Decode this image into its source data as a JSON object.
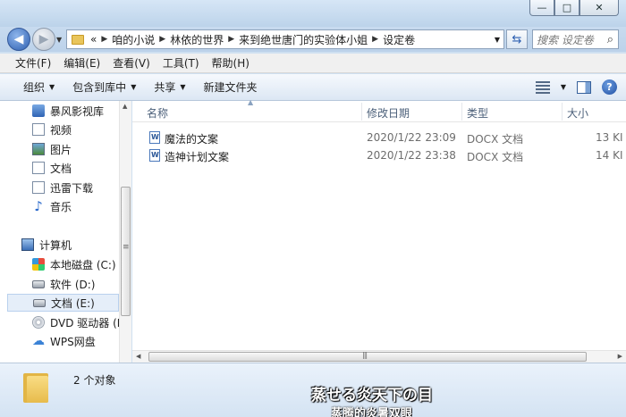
{
  "window": {
    "min": "—",
    "max": "□",
    "close": "✕"
  },
  "address": {
    "overflow": "«",
    "crumbs": [
      "咱的小说",
      "林依的世界",
      "来到绝世唐门的实验体小姐",
      "设定卷"
    ]
  },
  "search": {
    "placeholder": "搜索 设定卷"
  },
  "menubar": [
    "文件(F)",
    "编辑(E)",
    "查看(V)",
    "工具(T)",
    "帮助(H)"
  ],
  "toolbar": {
    "organize": "组织",
    "include_library": "包含到库中",
    "share": "共享",
    "new_folder": "新建文件夹"
  },
  "navpane": {
    "items": [
      {
        "label": "暴风影视库",
        "icon": "video-library-icon"
      },
      {
        "label": "视频",
        "icon": "video-icon"
      },
      {
        "label": "图片",
        "icon": "picture-icon"
      },
      {
        "label": "文档",
        "icon": "document-icon"
      },
      {
        "label": "迅雷下载",
        "icon": "download-icon"
      },
      {
        "label": "音乐",
        "icon": "music-icon"
      }
    ],
    "computer": "计算机",
    "drives": [
      {
        "label": "本地磁盘 (C:)",
        "icon": "windows-drive-icon"
      },
      {
        "label": "软件 (D:)",
        "icon": "drive-icon"
      },
      {
        "label": "文档 (E:)",
        "icon": "drive-icon",
        "selected": true
      },
      {
        "label": "DVD 驱动器 (F",
        "icon": "dvd-icon"
      },
      {
        "label": "WPS网盘",
        "icon": "cloud-icon"
      }
    ]
  },
  "columns": {
    "name": "名称",
    "modified": "修改日期",
    "type": "类型",
    "size": "大小"
  },
  "files": [
    {
      "name": "魔法的文案",
      "modified": "2020/1/22 23:09",
      "type": "DOCX 文档",
      "size": "13 KI"
    },
    {
      "name": "造神计划文案",
      "modified": "2020/1/22 23:38",
      "type": "DOCX 文档",
      "size": "14 KI"
    }
  ],
  "status": {
    "count": "2 个对象"
  },
  "overlay": {
    "subtitle_jp": "蒸せる炎天下の目",
    "subtitle_cn": "蒸腾的炎暑双眼"
  }
}
